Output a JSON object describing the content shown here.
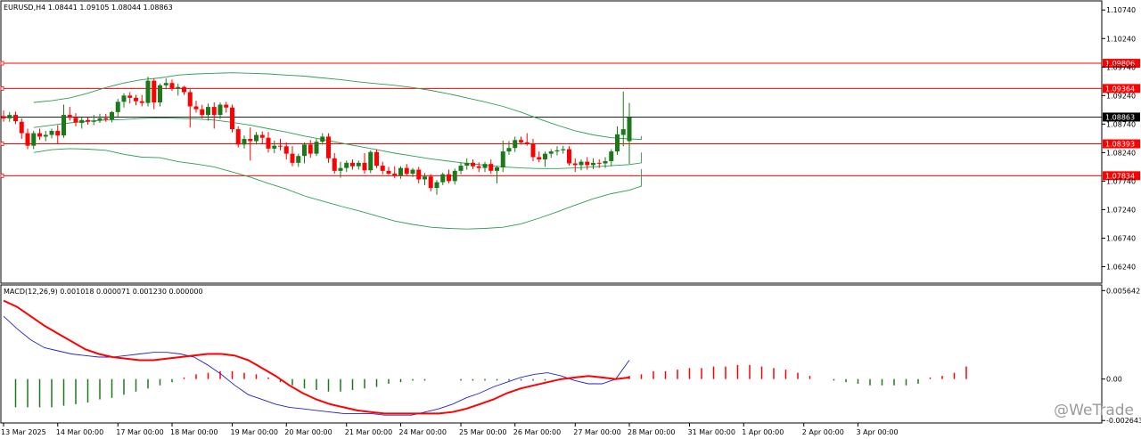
{
  "main_title": "EURUSD,H4  1.08441 1.09105 1.08044 1.08863",
  "macd_title": "MACD(12,26,9) 0.001018 0.000071 0.001230 0.000000",
  "watermark": "@WeTrade",
  "colors": {
    "bull": "#1a7a1a",
    "bear": "#ff0000",
    "line": "#ff0000",
    "band": "#2e9d55",
    "macd_main": "#ff0000",
    "macd_signal": "#2222cc",
    "hist_pos": "#ff0000",
    "hist_neg": "#1a7a1a",
    "current": "#000000"
  },
  "chart_data": [
    {
      "type": "candlestick",
      "symbol": "EURUSD",
      "timeframe": "H4",
      "ylim": [
        1.0595,
        1.109
      ],
      "price_ticks": [
        "1.10740",
        "1.10240",
        "1.09740",
        "1.09240",
        "1.08740",
        "1.08240",
        "1.07740",
        "1.07240",
        "1.06740",
        "1.06240"
      ],
      "price_tick_values": [
        1.1074,
        1.1024,
        1.0974,
        1.0924,
        1.0874,
        1.0824,
        1.0774,
        1.0724,
        1.0674,
        1.0624
      ],
      "levels": [
        {
          "label": "1.09806",
          "value": 1.09806
        },
        {
          "label": "1.09364",
          "value": 1.09364
        },
        {
          "label": "1.08393",
          "value": 1.08393
        },
        {
          "label": "1.07834",
          "value": 1.07834
        }
      ],
      "current_price": {
        "label": "1.08863",
        "value": 1.08863
      },
      "x_labels": [
        "13 Mar 2025",
        "14 Mar 00:00",
        "17 Mar 00:00",
        "18 Mar 00:00",
        "19 Mar 00:00",
        "20 Mar 00:00",
        "21 Mar 00:00",
        "24 Mar 00:00",
        "25 Mar 00:00",
        "26 Mar 00:00",
        "27 Mar 00:00",
        "28 Mar 00:00",
        "31 Mar 00:00",
        "1 Apr 00:00",
        "2 Apr 00:00",
        "3 Apr 00:00"
      ],
      "x_label_bar_index": [
        0,
        9,
        19,
        28,
        38,
        47,
        57,
        66,
        76,
        85,
        95,
        104,
        114,
        123,
        133,
        142
      ],
      "candles": [
        [
          1.0888,
          1.0898,
          1.0878,
          1.0884
        ],
        [
          1.0884,
          1.0895,
          1.0878,
          1.089
        ],
        [
          1.089,
          1.0896,
          1.0874,
          1.0879
        ],
        [
          1.0878,
          1.0884,
          1.0848,
          1.0858
        ],
        [
          1.0858,
          1.0866,
          1.083,
          1.0836
        ],
        [
          1.0836,
          1.0862,
          1.083,
          1.0858
        ],
        [
          1.0858,
          1.0866,
          1.0846,
          1.0852
        ],
        [
          1.0852,
          1.0862,
          1.0844,
          1.0855
        ],
        [
          1.0855,
          1.0866,
          1.0849,
          1.0862
        ],
        [
          1.0862,
          1.0872,
          1.0839,
          1.0854
        ],
        [
          1.0854,
          1.0908,
          1.085,
          1.089
        ],
        [
          1.089,
          1.0904,
          1.088,
          1.0885
        ],
        [
          1.0885,
          1.0893,
          1.087,
          1.0877
        ],
        [
          1.0876,
          1.0885,
          1.0866,
          1.0881
        ],
        [
          1.0881,
          1.0886,
          1.0873,
          1.0878
        ],
        [
          1.0878,
          1.089,
          1.0872,
          1.088
        ],
        [
          1.088,
          1.0892,
          1.0876,
          1.0884
        ],
        [
          1.0884,
          1.0892,
          1.0878,
          1.0882
        ],
        [
          1.0882,
          1.0897,
          1.0877,
          1.0895
        ],
        [
          1.0895,
          1.0918,
          1.0887,
          1.0913
        ],
        [
          1.0913,
          1.0928,
          1.0903,
          1.0924
        ],
        [
          1.0924,
          1.093,
          1.091,
          1.092
        ],
        [
          1.092,
          1.0925,
          1.0907,
          1.0914
        ],
        [
          1.0914,
          1.0925,
          1.0905,
          1.0911
        ],
        [
          1.0911,
          1.0957,
          1.0905,
          1.095
        ],
        [
          1.095,
          1.0954,
          1.09,
          1.0912
        ],
        [
          1.0912,
          1.0945,
          1.0905,
          1.0942
        ],
        [
          1.0942,
          1.0954,
          1.0935,
          1.0946
        ],
        [
          1.0946,
          1.0952,
          1.0932,
          1.0936
        ],
        [
          1.0936,
          1.0945,
          1.0924,
          1.0939
        ],
        [
          1.0939,
          1.0941,
          1.0925,
          1.093
        ],
        [
          1.093,
          1.0935,
          1.0868,
          1.0905
        ],
        [
          1.0905,
          1.0915,
          1.0894,
          1.09
        ],
        [
          1.09,
          1.0908,
          1.0884,
          1.089
        ],
        [
          1.089,
          1.091,
          1.088,
          1.0904
        ],
        [
          1.0904,
          1.0912,
          1.0866,
          1.089
        ],
        [
          1.089,
          1.0912,
          1.0883,
          1.0908
        ],
        [
          1.0908,
          1.0913,
          1.0894,
          1.0903
        ],
        [
          1.0903,
          1.0908,
          1.0859,
          1.0865
        ],
        [
          1.0865,
          1.087,
          1.0833,
          1.0838
        ],
        [
          1.0838,
          1.0854,
          1.0831,
          1.0848
        ],
        [
          1.0848,
          1.0868,
          1.081,
          1.0844
        ],
        [
          1.0844,
          1.086,
          1.0838,
          1.0855
        ],
        [
          1.0855,
          1.0861,
          1.084,
          1.085
        ],
        [
          1.085,
          1.086,
          1.0824,
          1.0831
        ],
        [
          1.0831,
          1.0845,
          1.0823,
          1.0836
        ],
        [
          1.0836,
          1.0848,
          1.0828,
          1.0835
        ],
        [
          1.0835,
          1.0842,
          1.0812,
          1.0822
        ],
        [
          1.0822,
          1.0835,
          1.08,
          1.0806
        ],
        [
          1.0806,
          1.0822,
          1.0799,
          1.0818
        ],
        [
          1.0818,
          1.0842,
          1.0805,
          1.0838
        ],
        [
          1.0838,
          1.0846,
          1.0815,
          1.0822
        ],
        [
          1.0822,
          1.0848,
          1.0818,
          1.0843
        ],
        [
          1.0843,
          1.0858,
          1.0838,
          1.0852
        ],
        [
          1.0852,
          1.0858,
          1.0806,
          1.0814
        ],
        [
          1.0814,
          1.0823,
          1.0787,
          1.0792
        ],
        [
          1.0792,
          1.0808,
          1.078,
          1.0797
        ],
        [
          1.0797,
          1.081,
          1.079,
          1.0806
        ],
        [
          1.0806,
          1.0812,
          1.0794,
          1.08
        ],
        [
          1.08,
          1.081,
          1.0794,
          1.0806
        ],
        [
          1.0806,
          1.0823,
          1.0787,
          1.0793
        ],
        [
          1.0793,
          1.0828,
          1.0788,
          1.0825
        ],
        [
          1.0825,
          1.083,
          1.0797,
          1.0801
        ],
        [
          1.0801,
          1.0808,
          1.0786,
          1.0792
        ],
        [
          1.0792,
          1.0799,
          1.0785,
          1.0787
        ],
        [
          1.0787,
          1.08,
          1.0779,
          1.0784
        ],
        [
          1.0784,
          1.08,
          1.0778,
          1.0797
        ],
        [
          1.0797,
          1.0804,
          1.0783,
          1.0787
        ],
        [
          1.0787,
          1.0797,
          1.0781,
          1.0794
        ],
        [
          1.0794,
          1.0799,
          1.077,
          1.0777
        ],
        [
          1.0777,
          1.0788,
          1.0767,
          1.0782
        ],
        [
          1.0782,
          1.0786,
          1.0756,
          1.0762
        ],
        [
          1.0762,
          1.0776,
          1.075,
          1.0772
        ],
        [
          1.0772,
          1.0789,
          1.0767,
          1.0786
        ],
        [
          1.0786,
          1.0794,
          1.077,
          1.0774
        ],
        [
          1.0774,
          1.0796,
          1.0768,
          1.0792
        ],
        [
          1.0792,
          1.0806,
          1.0786,
          1.0801
        ],
        [
          1.0801,
          1.0814,
          1.0794,
          1.0806
        ],
        [
          1.0806,
          1.0812,
          1.0795,
          1.08
        ],
        [
          1.08,
          1.0807,
          1.079,
          1.0797
        ],
        [
          1.0797,
          1.0808,
          1.079,
          1.0804
        ],
        [
          1.0804,
          1.0812,
          1.0787,
          1.0792
        ],
        [
          1.0792,
          1.0801,
          1.077,
          1.0798
        ],
        [
          1.0798,
          1.0845,
          1.079,
          1.0826
        ],
        [
          1.0826,
          1.0844,
          1.082,
          1.0832
        ],
        [
          1.0832,
          1.0852,
          1.0825,
          1.0846
        ],
        [
          1.0846,
          1.0852,
          1.0838,
          1.0842
        ],
        [
          1.0842,
          1.0858,
          1.0836,
          1.084
        ],
        [
          1.084,
          1.0848,
          1.0809,
          1.0816
        ],
        [
          1.0816,
          1.0826,
          1.0807,
          1.0812
        ],
        [
          1.0812,
          1.0826,
          1.0799,
          1.0822
        ],
        [
          1.0822,
          1.083,
          1.0815,
          1.0826
        ],
        [
          1.0826,
          1.0835,
          1.0819,
          1.0828
        ],
        [
          1.0828,
          1.0836,
          1.0822,
          1.083
        ],
        [
          1.083,
          1.0835,
          1.0801,
          1.0805
        ],
        [
          1.0805,
          1.0814,
          1.079,
          1.0802
        ],
        [
          1.0802,
          1.0812,
          1.0793,
          1.0808
        ],
        [
          1.0808,
          1.0816,
          1.0794,
          1.0802
        ],
        [
          1.0802,
          1.0814,
          1.0795,
          1.0806
        ],
        [
          1.0806,
          1.0812,
          1.0797,
          1.0805
        ],
        [
          1.0805,
          1.0816,
          1.0797,
          1.0809
        ],
        [
          1.0809,
          1.083,
          1.08,
          1.0826
        ],
        [
          1.0826,
          1.087,
          1.082,
          1.0856
        ],
        [
          1.0855,
          1.0931,
          1.0835,
          1.0865
        ],
        [
          1.0844,
          1.0911,
          1.0804,
          1.0886
        ]
      ],
      "bollinger_upper": [
        1.0912,
        1.0915,
        1.092,
        1.0928,
        1.0938,
        1.0946,
        1.0952,
        1.0955,
        1.096,
        1.0962,
        1.0963,
        1.0964,
        1.0963,
        1.0962,
        1.096,
        1.0958,
        1.0955,
        1.0952,
        1.0948,
        1.0945,
        1.0942,
        1.0938,
        1.0933,
        1.0927,
        1.092,
        1.0913,
        1.0905,
        1.0895,
        1.0883,
        1.0872,
        1.0862,
        1.0855,
        1.085,
        1.0848,
        1.0847,
        1.0847,
        1.0847,
        1.0848,
        1.0849,
        1.085,
        1.0851,
        1.0852,
        1.0852,
        1.0852,
        1.0853,
        1.0853,
        1.0853
      ],
      "bollinger_middle": [
        1.0868,
        1.0872,
        1.0876,
        1.0879,
        1.0881,
        1.0882,
        1.0884,
        1.0885,
        1.0884,
        1.0883,
        1.0881,
        1.0877,
        1.0872,
        1.0866,
        1.086,
        1.0853,
        1.0847,
        1.0841,
        1.0835,
        1.0829,
        1.0823,
        1.0818,
        1.0813,
        1.0809,
        1.0805,
        1.0802,
        1.0799,
        1.0797,
        1.0796,
        1.0796,
        1.0797,
        1.0799,
        1.0801,
        1.0803,
        1.0806,
        1.0809,
        1.0812,
        1.0814,
        1.0816,
        1.0817,
        1.0818,
        1.0818,
        1.0819,
        1.0819,
        1.0819,
        1.082,
        1.0824
      ],
      "bollinger_lower": [
        1.0824,
        1.0829,
        1.0831,
        1.083,
        1.0828,
        1.0821,
        1.0816,
        1.0815,
        1.0808,
        1.0804,
        1.0799,
        1.079,
        1.0781,
        1.077,
        1.076,
        1.0748,
        1.0739,
        1.073,
        1.0722,
        1.0713,
        1.0704,
        1.0698,
        1.0693,
        1.0691,
        1.069,
        1.0691,
        1.0693,
        1.0699,
        1.0709,
        1.072,
        1.0732,
        1.0743,
        1.0752,
        1.0758,
        1.0765,
        1.0771,
        1.0777,
        1.078,
        1.0783,
        1.0784,
        1.0785,
        1.0784,
        1.0786,
        1.0786,
        1.0785,
        1.0787,
        1.0795
      ]
    },
    {
      "type": "macd",
      "params": "12,26,9",
      "ylim": [
        -0.0028,
        0.006
      ],
      "ticks": [
        "0.005642",
        "0.00",
        "-0.002643"
      ],
      "tick_values": [
        0.005642,
        0.0,
        -0.002643
      ],
      "main": [
        0.005,
        0.0046,
        0.004,
        0.0034,
        0.0029,
        0.0024,
        0.0019,
        0.0016,
        0.0014,
        0.0013,
        0.0012,
        0.0012,
        0.0013,
        0.0014,
        0.0015,
        0.0016,
        0.0016,
        0.0015,
        0.0012,
        0.0007,
        0.0002,
        -0.0004,
        -0.0009,
        -0.0013,
        -0.0016,
        -0.0018,
        -0.002,
        -0.0021,
        -0.0022,
        -0.0022,
        -0.0022,
        -0.0022,
        -0.0022,
        -0.0021,
        -0.0019,
        -0.0016,
        -0.0013,
        -0.0009,
        -0.0006,
        -0.0004,
        -0.0002,
        0.0,
        0.0001,
        0.0002,
        0.0001,
        0.0,
        0.0001
      ],
      "signal": [
        0.004,
        0.0032,
        0.0025,
        0.002,
        0.0018,
        0.0016,
        0.0015,
        0.0014,
        0.0014,
        0.0015,
        0.0016,
        0.0017,
        0.0017,
        0.0016,
        0.0014,
        0.0009,
        0.0003,
        -0.0004,
        -0.001,
        -0.0013,
        -0.0016,
        -0.0018,
        -0.0019,
        -0.002,
        -0.0021,
        -0.0022,
        -0.0022,
        -0.0022,
        -0.0023,
        -0.0023,
        -0.0023,
        -0.0021,
        -0.0019,
        -0.0016,
        -0.0012,
        -0.0009,
        -0.0005,
        -0.0002,
        0.0001,
        0.0003,
        0.0004,
        0.0002,
        -0.0001,
        -0.0003,
        -0.0003,
        0.0,
        0.0012
      ],
      "histogram": [
        -0.0018,
        -0.0018,
        -0.0018,
        -0.0018,
        -0.0017,
        -0.0016,
        -0.0015,
        -0.0013,
        -0.0012,
        -0.001,
        -0.0008,
        -0.0006,
        -0.0004,
        -0.0002,
        0.0001,
        0.0003,
        0.0004,
        0.0005,
        0.0005,
        0.0004,
        0.0003,
        0.0001,
        -0.0002,
        -0.0004,
        -0.0006,
        -0.0007,
        -0.0008,
        -0.0008,
        -0.0007,
        -0.0006,
        -0.0005,
        -0.0003,
        -0.0002,
        -0.0001,
        -0.0001,
        0.0,
        0.0,
        -0.0001,
        -0.0001,
        -0.0001,
        -0.0001,
        -0.0001,
        -0.0001,
        -0.0001,
        -0.0001,
        0.0,
        0.0,
        0.0,
        0.0,
        0.0,
        0.0,
        0.0002,
        0.0003,
        0.0005,
        0.0005,
        0.0006,
        0.0007,
        0.0007,
        0.0008,
        0.0008,
        0.0009,
        0.0009,
        0.0008,
        0.0007,
        0.0006,
        0.0004,
        0.0002,
        0.0,
        -0.0001,
        -0.0002,
        -0.0003,
        -0.0004,
        -0.0004,
        -0.0004,
        -0.0004,
        -0.0003,
        0.0001,
        0.0002,
        0.0004,
        0.0008
      ]
    }
  ]
}
